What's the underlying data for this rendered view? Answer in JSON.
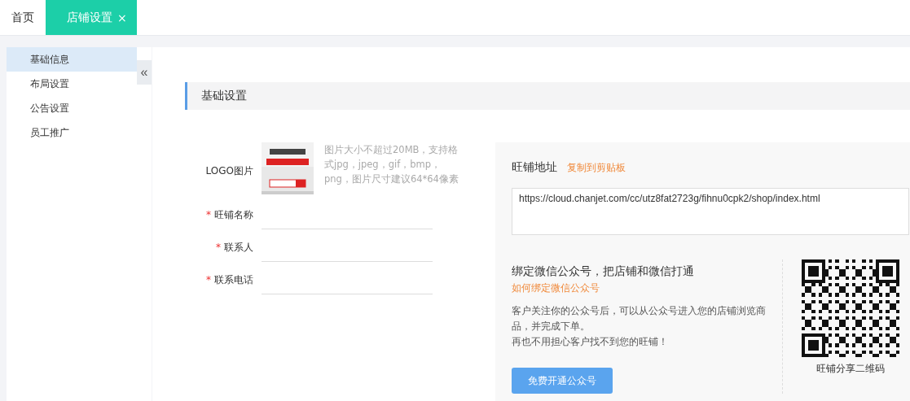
{
  "tabs": [
    {
      "label": "首页",
      "selected": false
    },
    {
      "label": "店铺设置",
      "selected": true,
      "close": "×"
    }
  ],
  "sidebar": {
    "items": [
      {
        "label": "基础信息",
        "selected": true
      },
      {
        "label": "布局设置",
        "selected": false
      },
      {
        "label": "公告设置",
        "selected": false
      },
      {
        "label": "员工推广",
        "selected": false
      }
    ],
    "collapse": "«"
  },
  "section_title": "基础设置",
  "form": {
    "logo": {
      "label": "LOGO图片",
      "hint": "图片大小不超过20MB，支持格式jpg，jpeg，gif，bmp，png，图片尺寸建议64*64像素"
    },
    "fields": [
      {
        "label": "旺铺名称",
        "required": true,
        "required_mark": "*"
      },
      {
        "label": "联系人",
        "required": true,
        "required_mark": "*"
      },
      {
        "label": "联系电话",
        "required": true,
        "required_mark": "*"
      }
    ]
  },
  "shop_address": {
    "title": "旺铺地址",
    "copy_link": "复制到剪贴板",
    "url": "https://cloud.chanjet.com/cc/utz8fat2723g/fihnu0cpk2/shop/index.html"
  },
  "wechat": {
    "title": "绑定微信公众号，把店铺和微信打通",
    "help_link": "如何绑定微信公众号",
    "paragraphs": [
      "客户关注你的公众号后，可以从公众号进入您的店铺浏览商品，并完成下单。",
      "再也不用担心客户找不到您的旺铺！"
    ],
    "button": "免费开通公众号"
  },
  "qr": {
    "caption": "旺铺分享二维码"
  }
}
